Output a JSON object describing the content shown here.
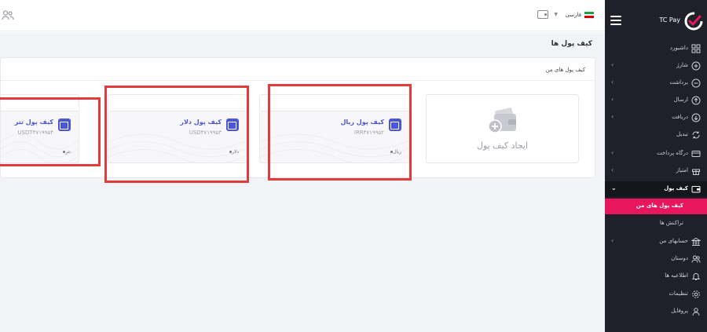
{
  "app": {
    "brand_name": "TC Pay"
  },
  "topbar": {
    "language": "فارسی"
  },
  "sidebar": {
    "items": [
      {
        "label": "داشبورد",
        "icon": "grid-icon",
        "has_arrow": false
      },
      {
        "label": "شارژ",
        "icon": "plus-circle-icon",
        "has_arrow": true
      },
      {
        "label": "برداشت",
        "icon": "minus-circle-icon",
        "has_arrow": true
      },
      {
        "label": "ارسال",
        "icon": "arrow-up-circle-icon",
        "has_arrow": true
      },
      {
        "label": "دریافت",
        "icon": "arrow-down-circle-icon",
        "has_arrow": true
      },
      {
        "label": "تبدیل",
        "icon": "refresh-icon",
        "has_arrow": false
      },
      {
        "label": "درگاه پرداخت",
        "icon": "card-icon",
        "has_arrow": true
      },
      {
        "label": "امتیاز",
        "icon": "gift-icon",
        "has_arrow": true
      },
      {
        "label": "کیف پول",
        "icon": "wallet-icon",
        "has_arrow": true,
        "active": true
      }
    ],
    "submenu": [
      {
        "label": "کیف پول های من",
        "active": true
      },
      {
        "label": "تراکنش ها",
        "active": false
      }
    ],
    "items_bottom": [
      {
        "label": "حسابهای من",
        "icon": "bank-icon",
        "has_arrow": true
      },
      {
        "label": "دوستان",
        "icon": "users-icon",
        "has_arrow": false
      },
      {
        "label": "اطلاعیه ها",
        "icon": "bell-icon",
        "has_arrow": false
      },
      {
        "label": "تنظیمات",
        "icon": "gear-icon",
        "has_arrow": false
      },
      {
        "label": "پروفایل",
        "icon": "user-icon",
        "has_arrow": false
      }
    ],
    "arrow_glyph": "‹",
    "active_arrow_glyph": "⌄"
  },
  "page": {
    "title": "کیف پول ها",
    "panel_title": "کیف پول های من",
    "create_label": "ایجاد کیف پول"
  },
  "wallets": [
    {
      "name": "کیف پول ریال",
      "code": "IRR۴۷۱۹۹۵۲",
      "currency": "ریال"
    },
    {
      "name": "کیف پول دلار",
      "code": "USD۴۷۱۹۹۵۳",
      "currency": "دلار"
    },
    {
      "name": "کیف پول تتر",
      "code": "USDT۴۷۱۹۹۵۴",
      "currency": "تتر"
    }
  ],
  "colors": {
    "sidebar_bg": "#1f2029",
    "accent_pink": "#e8175d",
    "wallet_blue": "#4b56d6",
    "highlight_red": "#e23b3b"
  }
}
